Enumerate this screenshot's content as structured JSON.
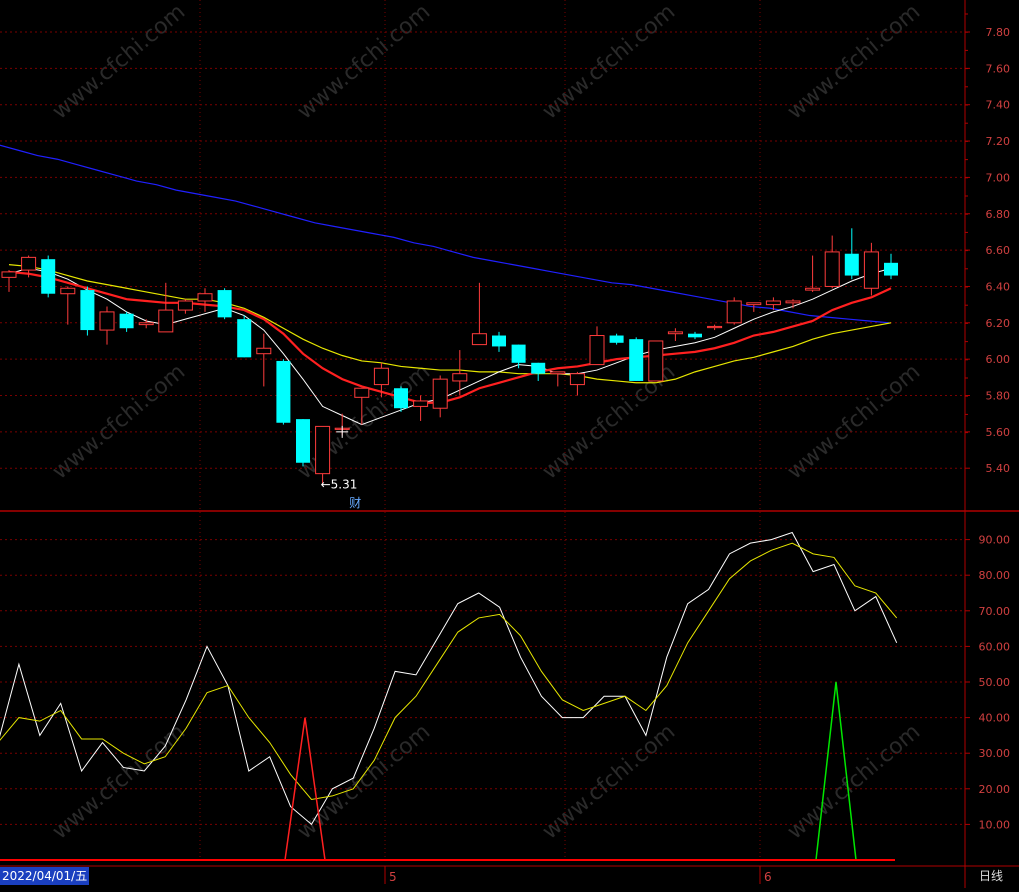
{
  "chart_data": [
    {
      "type": "candlestick",
      "title": "",
      "ylim": [
        5.2,
        7.95
      ],
      "y_ticks": [
        "7.80",
        "7.60",
        "7.40",
        "7.20",
        "7.00",
        "6.80",
        "6.60",
        "6.40",
        "6.20",
        "6.00",
        "5.80",
        "5.60",
        "5.40"
      ],
      "grid": true,
      "candles": [
        {
          "o": 6.45,
          "h": 6.49,
          "l": 6.37,
          "c": 6.48
        },
        {
          "o": 6.49,
          "h": 6.57,
          "l": 6.45,
          "c": 6.56
        },
        {
          "o": 6.55,
          "h": 6.57,
          "l": 6.34,
          "c": 6.36
        },
        {
          "o": 6.36,
          "h": 6.4,
          "l": 6.19,
          "c": 6.39
        },
        {
          "o": 6.38,
          "h": 6.4,
          "l": 6.13,
          "c": 6.16
        },
        {
          "o": 6.16,
          "h": 6.29,
          "l": 6.08,
          "c": 6.26
        },
        {
          "o": 6.25,
          "h": 6.26,
          "l": 6.15,
          "c": 6.17
        },
        {
          "o": 6.19,
          "h": 6.22,
          "l": 6.17,
          "c": 6.2
        },
        {
          "o": 6.15,
          "h": 6.42,
          "l": 6.15,
          "c": 6.27
        },
        {
          "o": 6.27,
          "h": 6.33,
          "l": 6.25,
          "c": 6.32
        },
        {
          "o": 6.32,
          "h": 6.39,
          "l": 6.26,
          "c": 6.36
        },
        {
          "o": 6.38,
          "h": 6.39,
          "l": 6.22,
          "c": 6.23
        },
        {
          "o": 6.22,
          "h": 6.24,
          "l": 6.01,
          "c": 6.01
        },
        {
          "o": 6.03,
          "h": 6.14,
          "l": 5.85,
          "c": 6.06
        },
        {
          "o": 5.99,
          "h": 6.0,
          "l": 5.64,
          "c": 5.65
        },
        {
          "o": 5.67,
          "h": 5.67,
          "l": 5.41,
          "c": 5.43
        },
        {
          "o": 5.37,
          "h": 5.63,
          "l": 5.31,
          "c": 5.63
        },
        {
          "o": 5.62,
          "h": 5.7,
          "l": 5.58,
          "c": 5.62
        },
        {
          "o": 5.79,
          "h": 5.84,
          "l": 5.64,
          "c": 5.84
        },
        {
          "o": 5.86,
          "h": 5.98,
          "l": 5.79,
          "c": 5.95
        },
        {
          "o": 5.84,
          "h": 5.85,
          "l": 5.71,
          "c": 5.73
        },
        {
          "o": 5.74,
          "h": 5.8,
          "l": 5.66,
          "c": 5.77
        },
        {
          "o": 5.73,
          "h": 5.91,
          "l": 5.68,
          "c": 5.89
        },
        {
          "o": 5.88,
          "h": 6.05,
          "l": 5.8,
          "c": 5.92
        },
        {
          "o": 6.08,
          "h": 6.42,
          "l": 6.08,
          "c": 6.14
        },
        {
          "o": 6.13,
          "h": 6.15,
          "l": 6.04,
          "c": 6.07
        },
        {
          "o": 6.08,
          "h": 6.08,
          "l": 5.95,
          "c": 5.98
        },
        {
          "o": 5.98,
          "h": 5.98,
          "l": 5.88,
          "c": 5.92
        },
        {
          "o": 5.92,
          "h": 5.93,
          "l": 5.85,
          "c": 5.93
        },
        {
          "o": 5.86,
          "h": 5.93,
          "l": 5.8,
          "c": 5.92
        },
        {
          "o": 5.97,
          "h": 6.18,
          "l": 5.97,
          "c": 6.13
        },
        {
          "o": 6.13,
          "h": 6.14,
          "l": 6.08,
          "c": 6.09
        },
        {
          "o": 6.11,
          "h": 6.12,
          "l": 5.88,
          "c": 5.88
        },
        {
          "o": 5.88,
          "h": 6.1,
          "l": 5.88,
          "c": 6.1
        },
        {
          "o": 6.14,
          "h": 6.17,
          "l": 6.1,
          "c": 6.15
        },
        {
          "o": 6.14,
          "h": 6.15,
          "l": 6.11,
          "c": 6.12
        },
        {
          "o": 6.18,
          "h": 6.19,
          "l": 6.16,
          "c": 6.18
        },
        {
          "o": 6.2,
          "h": 6.34,
          "l": 6.19,
          "c": 6.32
        },
        {
          "o": 6.3,
          "h": 6.31,
          "l": 6.26,
          "c": 6.31
        },
        {
          "o": 6.3,
          "h": 6.34,
          "l": 6.27,
          "c": 6.32
        },
        {
          "o": 6.31,
          "h": 6.33,
          "l": 6.28,
          "c": 6.32
        },
        {
          "o": 6.38,
          "h": 6.57,
          "l": 6.37,
          "c": 6.39
        },
        {
          "o": 6.4,
          "h": 6.68,
          "l": 6.39,
          "c": 6.59
        },
        {
          "o": 6.58,
          "h": 6.72,
          "l": 6.44,
          "c": 6.46
        },
        {
          "o": 6.39,
          "h": 6.64,
          "l": 6.35,
          "c": 6.59
        },
        {
          "o": 6.53,
          "h": 6.58,
          "l": 6.44,
          "c": 6.46
        }
      ],
      "ma_white": [
        6.47,
        6.5,
        6.48,
        6.44,
        6.38,
        6.33,
        6.26,
        6.21,
        6.19,
        6.22,
        6.25,
        6.28,
        6.24,
        6.16,
        6.03,
        5.89,
        5.74,
        5.69,
        5.64,
        5.68,
        5.72,
        5.76,
        5.78,
        5.83,
        5.88,
        5.93,
        5.97,
        5.96,
        5.92,
        5.92,
        5.94,
        5.98,
        6.02,
        6.05,
        6.07,
        6.09,
        6.12,
        6.17,
        6.22,
        6.26,
        6.29,
        6.33,
        6.38,
        6.43,
        6.47,
        6.5
      ],
      "ma_red": [
        6.48,
        6.47,
        6.45,
        6.42,
        6.39,
        6.36,
        6.33,
        6.32,
        6.31,
        6.31,
        6.3,
        6.29,
        6.27,
        6.22,
        6.14,
        6.03,
        5.95,
        5.89,
        5.85,
        5.82,
        5.79,
        5.76,
        5.76,
        5.79,
        5.84,
        5.87,
        5.9,
        5.93,
        5.95,
        5.96,
        5.98,
        6.0,
        6.01,
        6.02,
        6.03,
        6.04,
        6.06,
        6.09,
        6.13,
        6.15,
        6.18,
        6.21,
        6.27,
        6.31,
        6.34,
        6.39
      ],
      "ma_yellow": [
        6.52,
        6.51,
        6.49,
        6.46,
        6.43,
        6.41,
        6.39,
        6.37,
        6.35,
        6.33,
        6.33,
        6.31,
        6.28,
        6.23,
        6.17,
        6.11,
        6.06,
        6.02,
        5.99,
        5.98,
        5.96,
        5.95,
        5.94,
        5.94,
        5.93,
        5.93,
        5.92,
        5.92,
        5.92,
        5.91,
        5.89,
        5.88,
        5.87,
        5.87,
        5.89,
        5.93,
        5.96,
        5.99,
        6.01,
        6.04,
        6.07,
        6.11,
        6.14,
        6.16,
        6.18,
        6.2
      ],
      "ma_blue": [
        7.18,
        7.15,
        7.12,
        7.1,
        7.07,
        7.04,
        7.01,
        6.98,
        6.96,
        6.93,
        6.91,
        6.89,
        6.87,
        6.84,
        6.81,
        6.78,
        6.75,
        6.73,
        6.71,
        6.69,
        6.67,
        6.64,
        6.62,
        6.59,
        6.56,
        6.54,
        6.52,
        6.5,
        6.48,
        6.46,
        6.44,
        6.42,
        6.41,
        6.39,
        6.37,
        6.35,
        6.33,
        6.31,
        6.29,
        6.28,
        6.26,
        6.24,
        6.23,
        6.22,
        6.21,
        6.2
      ],
      "low_label": "5.31",
      "low_marker_index": 16,
      "event_marker": "财",
      "event_marker_index": 17,
      "colors": {
        "up": "#ff3c3c",
        "down": "#00ffff",
        "ma_white": "#ffffff",
        "ma_red": "#ff2020",
        "ma_yellow": "#e6e600",
        "ma_blue": "#2020ff",
        "grid": "#7a0000",
        "axis": "#b00000"
      }
    },
    {
      "type": "line",
      "title": "",
      "ylim": [
        0,
        97
      ],
      "y_ticks": [
        "90.00",
        "80.00",
        "70.00",
        "60.00",
        "50.00",
        "40.00",
        "30.00",
        "20.00",
        "10.00"
      ],
      "grid": true,
      "series": [
        {
          "color": "#ffffff",
          "values": [
            33,
            55,
            35,
            44,
            25,
            33,
            26,
            25,
            32,
            45,
            60,
            49,
            25,
            29,
            15,
            10,
            20,
            23,
            37,
            53,
            52,
            62,
            72,
            75,
            71,
            57,
            46,
            40,
            40,
            46,
            46,
            35,
            57,
            72,
            76,
            86,
            89,
            90,
            92,
            81,
            83,
            70,
            74,
            61
          ]
        },
        {
          "color": "#e6e600",
          "values": [
            33,
            40,
            39,
            42,
            34,
            34,
            30,
            27,
            29,
            37,
            47,
            49,
            40,
            33,
            24,
            17,
            18,
            20,
            28,
            40,
            46,
            55,
            64,
            68,
            69,
            63,
            53,
            45,
            42,
            44,
            46,
            42,
            49,
            61,
            70,
            79,
            84,
            87,
            89,
            86,
            85,
            77,
            75,
            68
          ]
        },
        {
          "color": "#ff2020",
          "x": [
            285,
            305,
            325
          ],
          "values": [
            0,
            40,
            0
          ]
        },
        {
          "color": "#00e600",
          "x": [
            816,
            836,
            856
          ],
          "values": [
            0,
            50,
            0
          ]
        }
      ],
      "x_ticks": [
        "5",
        "6"
      ],
      "date_label": "2022/04/01/五",
      "period_label": "日线",
      "colors": {
        "baseline": "#ff0000",
        "grid": "#7a0000",
        "axis": "#b00000"
      }
    }
  ],
  "watermark": "www.cfchi.com"
}
